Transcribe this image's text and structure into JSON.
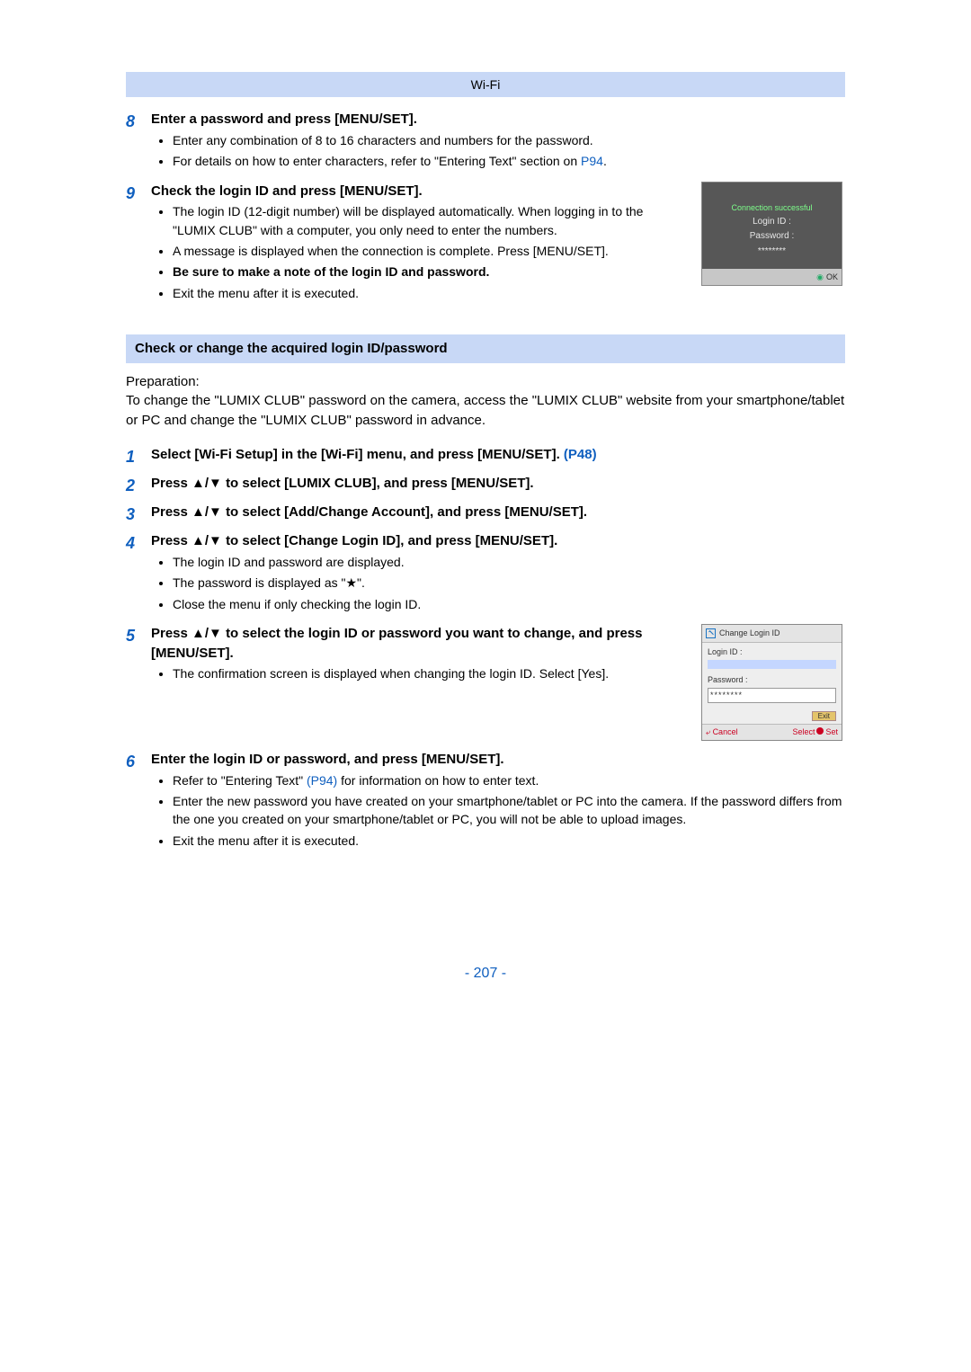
{
  "header": "Wi-Fi",
  "step8": {
    "num": "8",
    "title": "Enter a password and press [MENU/SET].",
    "b1": "Enter any combination of 8 to 16 characters and numbers for the password.",
    "b2a": "For details on how to enter characters, refer to \"Entering Text\" section on ",
    "b2link": "P94",
    "b2c": "."
  },
  "step9": {
    "num": "9",
    "title": "Check the login ID and press [MENU/SET].",
    "b1": "The login ID (12-digit number) will be displayed automatically. When logging in to the \"LUMIX CLUB\" with a computer, you only need to enter the numbers.",
    "b2": "A message is displayed when the connection is complete. Press [MENU/SET].",
    "b3": "Be sure to make a note of the login ID and password.",
    "b4": "Exit the menu after it is executed."
  },
  "scr1": {
    "success": "Connection successful",
    "login": "Login ID :",
    "pass": "Password :",
    "dots": "********",
    "ok": "OK"
  },
  "section2": "Check or change the acquired login ID/password",
  "prep_label": "Preparation:",
  "prep_text": "To change the \"LUMIX CLUB\" password on the camera, access the \"LUMIX CLUB\" website from your smartphone/tablet or PC and change the \"LUMIX CLUB\" password in advance.",
  "s1": {
    "num": "1",
    "t1": "Select [Wi-Fi Setup] in the [Wi-Fi] menu, and press [MENU/SET]. ",
    "link": "(P48)"
  },
  "s2": {
    "num": "2",
    "t": "Press ▲/▼ to select [LUMIX CLUB], and press [MENU/SET]."
  },
  "s3": {
    "num": "3",
    "t": "Press ▲/▼ to select [Add/Change Account], and press [MENU/SET]."
  },
  "s4": {
    "num": "4",
    "t": "Press ▲/▼ to select [Change Login ID], and press [MENU/SET].",
    "b1": "The login ID and password are displayed.",
    "b2": "The password is displayed as \"★\".",
    "b3": "Close the menu if only checking the login ID."
  },
  "s5": {
    "num": "5",
    "t": "Press ▲/▼ to select the login ID or password you want to change, and press [MENU/SET].",
    "b1": "The confirmation screen is displayed when changing the login ID. Select [Yes]."
  },
  "scr2": {
    "title": "Change Login ID",
    "login": "Login ID :",
    "pass": "Password :",
    "dots": "********",
    "exit": "Exit",
    "cancel": "Cancel",
    "select": "Select",
    "set": "Set"
  },
  "s6": {
    "num": "6",
    "t": "Enter the login ID or password, and press [MENU/SET].",
    "b1a": "Refer to \"Entering Text\" ",
    "b1link": "(P94)",
    "b1b": " for information on how to enter text.",
    "b2": "Enter the new password you have created on your smartphone/tablet or PC into the camera. If the password differs from the one you created on your smartphone/tablet or PC, you will not be able to upload images.",
    "b3": "Exit the menu after it is executed."
  },
  "pagenum": "- 207 -"
}
